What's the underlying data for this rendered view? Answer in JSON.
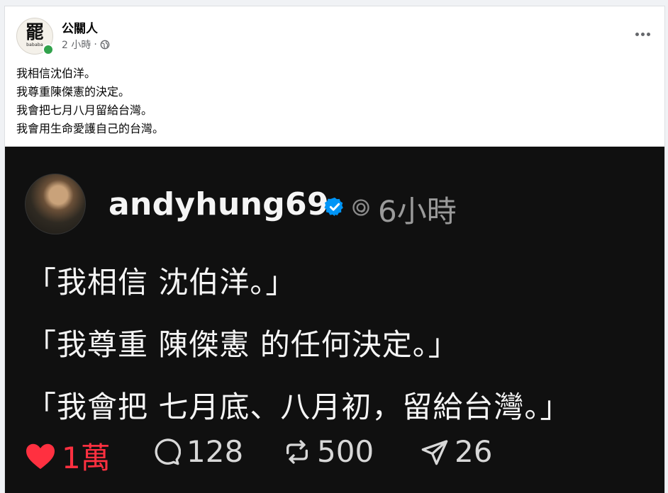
{
  "post": {
    "page_name": "公關人",
    "time": "2 小時",
    "separator": "·",
    "avatar_text": "罷",
    "avatar_subtext": "bababa",
    "lines": [
      "我相信沈伯洋。",
      "我尊重陳傑憲的決定。",
      "我會把七月八月留給台灣。",
      "我會用生命愛護自己的台灣。"
    ]
  },
  "threads": {
    "username": "andyhung69",
    "time": "6小時",
    "lines": [
      "「我相信 沈伯洋。」",
      "「我尊重 陳傑憲 的任何決定。」",
      "「我會把 七月底、八月初，留給台灣。」"
    ],
    "likes": "1萬",
    "comments": "128",
    "reposts": "500",
    "shares": "26"
  },
  "colors": {
    "like_red": "#ff3040",
    "verified_blue": "#0095f6",
    "online_green": "#31a24c"
  },
  "icons": [
    "more-icon",
    "globe-icon",
    "verified-icon",
    "threads-icon",
    "heart-icon",
    "comment-icon",
    "repost-icon",
    "share-icon"
  ]
}
